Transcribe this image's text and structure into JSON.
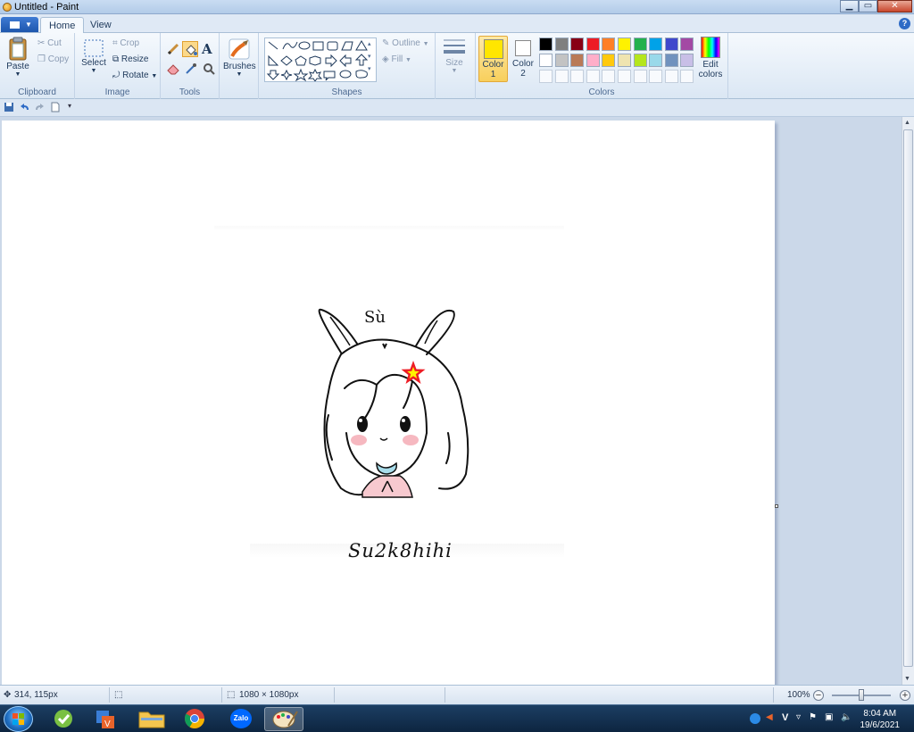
{
  "window": {
    "title": "Untitled - Paint"
  },
  "tabs": [
    {
      "label": "Home",
      "active": true
    },
    {
      "label": "View",
      "active": false
    }
  ],
  "ribbon": {
    "clipboard": {
      "paste": "Paste",
      "cut": "Cut",
      "copy": "Copy",
      "label": "Clipboard"
    },
    "image": {
      "select": "Select",
      "crop": "Crop",
      "resize": "Resize",
      "rotate": "Rotate",
      "label": "Image"
    },
    "tools": {
      "label": "Tools"
    },
    "brushes": {
      "label": "Brushes"
    },
    "shapes": {
      "outline": "Outline",
      "fill": "Fill",
      "label": "Shapes"
    },
    "size": {
      "label": "Size"
    },
    "colors": {
      "color1_label": "Color",
      "color1_num": "1",
      "color2_label": "Color",
      "color2_num": "2",
      "edit_label": "Edit",
      "edit_label2": "colors",
      "label": "Colors",
      "color1_value": "#ffe600",
      "color2_value": "#ffffff",
      "palette_row1": [
        "#000000",
        "#7f7f7f",
        "#880015",
        "#ed1c24",
        "#ff7f27",
        "#fff200",
        "#22b14c",
        "#00a2e8",
        "#3f48cc",
        "#a349a4"
      ],
      "palette_row2": [
        "#ffffff",
        "#c3c3c3",
        "#b97a57",
        "#ffaec9",
        "#ffc90e",
        "#efe4b0",
        "#b5e61d",
        "#99d9ea",
        "#7092be",
        "#c8bfe7"
      ]
    }
  },
  "canvas": {
    "drawing_name": "Sù",
    "signature": "Su2k8hihi",
    "star_color": "#ed1c24",
    "star_center_color": "#fff200"
  },
  "status": {
    "cursor_pos": "314, 115px",
    "canvas_size": "1080 × 1080px",
    "zoom": "100%"
  },
  "taskbar": {
    "apps": [
      "start-icon",
      "app-icon",
      "app-icon",
      "folder-icon",
      "chrome-icon",
      "zalo-icon",
      "paint-icon"
    ],
    "zalo_label": "Zalo",
    "tray_letter": "V",
    "time": "8:04 AM",
    "date": "19/6/2021"
  }
}
